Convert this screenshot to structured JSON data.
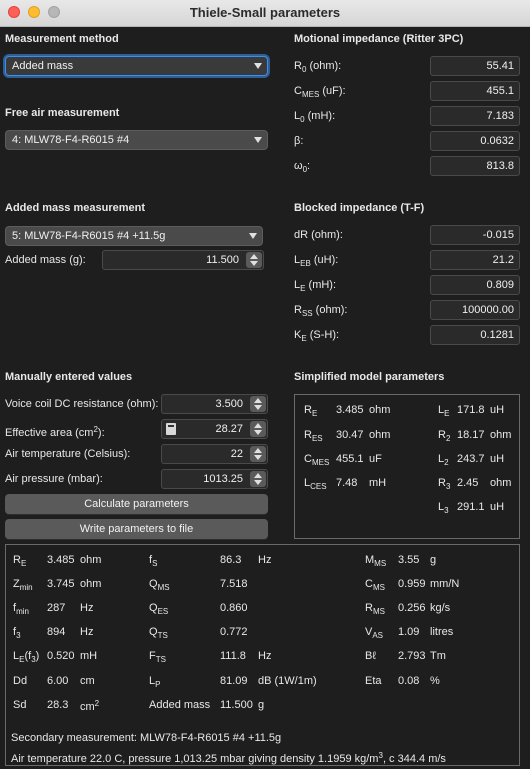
{
  "window": {
    "title": "Thiele-Small parameters"
  },
  "measurement_method": {
    "heading": "Measurement method",
    "selected": "Added mass"
  },
  "free_air": {
    "heading": "Free air measurement",
    "selected": "4: MLW78-F4-R6015 #4"
  },
  "added_mass_meas": {
    "heading": "Added mass measurement",
    "selected": "5: MLW78-F4-R6015 #4 +11.5g",
    "mass_label": "Added mass (g):",
    "mass_value": "11.500"
  },
  "motional": {
    "heading": "Motional impedance (Ritter 3PC)",
    "rows": [
      {
        "label": "R",
        "sub": "0",
        "unit": " (ohm):",
        "value": "55.41"
      },
      {
        "label": "C",
        "sub": "MES",
        "unit": " (uF):",
        "value": "455.1"
      },
      {
        "label": "L",
        "sub": "0",
        "unit": " (mH):",
        "value": "7.183"
      },
      {
        "label": "β:",
        "sub": "",
        "unit": "",
        "value": "0.0632"
      },
      {
        "label": "ω",
        "sub": "0",
        "unit": ":",
        "value": "813.8"
      }
    ]
  },
  "blocked": {
    "heading": "Blocked impedance (T-F)",
    "rows": [
      {
        "label": "dR (ohm):",
        "sub": "",
        "unit": "",
        "value": "-0.015"
      },
      {
        "label": "L",
        "sub": "EB",
        "unit": " (uH):",
        "value": "21.2"
      },
      {
        "label": "L",
        "sub": "E",
        "unit": " (mH):",
        "value": "0.809"
      },
      {
        "label": "R",
        "sub": "SS",
        "unit": " (ohm):",
        "value": "100000.00"
      },
      {
        "label": "K",
        "sub": "E",
        "unit": " (S-H):",
        "value": "0.1281"
      }
    ]
  },
  "manual": {
    "heading": "Manually entered values",
    "voice_coil_label": "Voice coil DC resistance (ohm):",
    "voice_coil_value": "3.500",
    "area_label_pre": "Effective area (cm",
    "area_label_sup": "2",
    "area_label_post": "):",
    "area_value": "28.27",
    "temp_label": "Air temperature (Celsius):",
    "temp_value": "22",
    "pressure_label": "Air pressure (mbar):",
    "pressure_value": "1013.25",
    "calc_button": "Calculate parameters",
    "write_button": "Write parameters to file"
  },
  "simplified": {
    "heading": "Simplified model parameters",
    "left": [
      {
        "sym": "R",
        "sub": "E",
        "value": "3.485",
        "unit": "ohm"
      },
      {
        "sym": "R",
        "sub": "ES",
        "value": "30.47",
        "unit": "ohm"
      },
      {
        "sym": "C",
        "sub": "MES",
        "value": "455.1",
        "unit": "uF"
      },
      {
        "sym": "L",
        "sub": "CES",
        "value": "7.48",
        "unit": "mH"
      }
    ],
    "right": [
      {
        "sym": "L",
        "sub": "E",
        "value": "171.8",
        "unit": "uH"
      },
      {
        "sym": "R",
        "sub": "2",
        "value": "18.17",
        "unit": "ohm"
      },
      {
        "sym": "L",
        "sub": "2",
        "value": "243.7",
        "unit": "uH"
      },
      {
        "sym": "R",
        "sub": "3",
        "value": "2.45",
        "unit": "ohm"
      },
      {
        "sym": "L",
        "sub": "3",
        "value": "291.1",
        "unit": "uH"
      }
    ]
  },
  "results": {
    "col1": [
      {
        "sym": "R",
        "sub": "E",
        "value": "3.485",
        "unit": "ohm"
      },
      {
        "sym": "Z",
        "sub": "min",
        "value": "3.745",
        "unit": "ohm"
      },
      {
        "sym": "f",
        "sub": "min",
        "value": "287",
        "unit": "Hz"
      },
      {
        "sym": "f",
        "sub": "3",
        "value": "894",
        "unit": "Hz"
      },
      {
        "sym": "L",
        "sub": "E",
        "extra": "(f",
        "extra_sub": "3",
        "extra_end": ")",
        "value": "0.520",
        "unit": "mH"
      },
      {
        "sym": "Dd",
        "sub": "",
        "value": "6.00",
        "unit": "cm"
      },
      {
        "sym": "Sd",
        "sub": "",
        "value": "28.3",
        "unit": "cm",
        "unit_sup": "2"
      }
    ],
    "col2": [
      {
        "sym": "f",
        "sub": "S",
        "value": "86.3",
        "unit": "Hz"
      },
      {
        "sym": "Q",
        "sub": "MS",
        "value": "7.518",
        "unit": ""
      },
      {
        "sym": "Q",
        "sub": "ES",
        "value": "0.860",
        "unit": ""
      },
      {
        "sym": "Q",
        "sub": "TS",
        "value": "0.772",
        "unit": ""
      },
      {
        "sym": "F",
        "sub": "TS",
        "value": "111.8",
        "unit": "Hz"
      },
      {
        "sym": "L",
        "sub": "P",
        "value": "81.09",
        "unit": "dB (1W/1m)"
      },
      {
        "sym": "Added mass",
        "sub": "",
        "value": "11.500",
        "unit": "g"
      }
    ],
    "col3": [
      {
        "sym": "M",
        "sub": "MS",
        "value": "3.55",
        "unit": "g"
      },
      {
        "sym": "C",
        "sub": "MS",
        "value": "0.959",
        "unit": "mm/N"
      },
      {
        "sym": "R",
        "sub": "MS",
        "value": "0.256",
        "unit": "kg/s"
      },
      {
        "sym": "V",
        "sub": "AS",
        "value": "1.09",
        "unit": "litres"
      },
      {
        "sym": "Bℓ",
        "sub": "",
        "value": "2.793",
        "unit": "Tm"
      },
      {
        "sym": "Eta",
        "sub": "",
        "value": "0.08",
        "unit": "%"
      }
    ],
    "secondary": "Secondary measurement: MLW78-F4-R6015 #4 +11.5g",
    "air_line_pre": "Air temperature 22.0 C, pressure 1,013.25 mbar giving density 1.1959 kg/m",
    "air_line_sup": "3",
    "air_line_post": ", c 344.4 m/s"
  }
}
